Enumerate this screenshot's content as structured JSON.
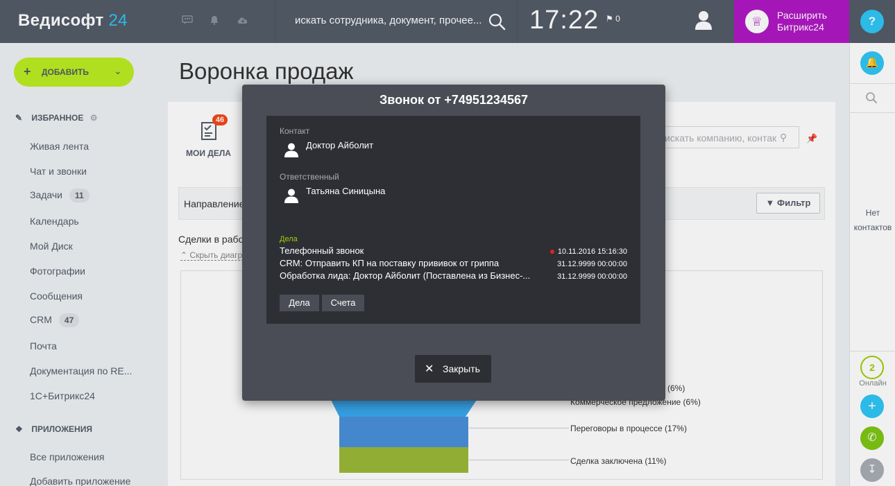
{
  "header": {
    "logo_main": "Ведисофт",
    "logo_num": "24",
    "search_placeholder": "искать сотрудника, документ, прочее...",
    "clock": "17:22",
    "flag_count": "0",
    "extend_line1": "Расширить",
    "extend_line2": "Битрикс24",
    "help": "?"
  },
  "sidebar": {
    "add_label": "ДОБАВИТЬ",
    "favorites_title": "ИЗБРАННОЕ",
    "items": [
      {
        "label": "Живая лента"
      },
      {
        "label": "Чат и звонки"
      },
      {
        "label": "Задачи",
        "badge": "11"
      },
      {
        "label": "Календарь"
      },
      {
        "label": "Мой Диск"
      },
      {
        "label": "Фотографии"
      },
      {
        "label": "Сообщения"
      },
      {
        "label": "CRM",
        "badge": "47"
      },
      {
        "label": "Почта"
      },
      {
        "label": "Документация по RE..."
      },
      {
        "label": "1С+Битрикс24"
      }
    ],
    "apps_title": "ПРИЛОЖЕНИЯ",
    "apps_items": [
      {
        "label": "Все приложения"
      },
      {
        "label": "Добавить приложение"
      }
    ]
  },
  "main": {
    "title": "Воронка продаж",
    "my_tasks_label": "МОИ ДЕЛА",
    "my_tasks_badge": "46",
    "search_placeholder": "искать компанию, контак",
    "direction_label": "Направление",
    "filter_label": "Фильтр",
    "deals_label": "Сделки в рабо",
    "hide_chart": "Скрыть диагра",
    "legend": [
      {
        "label": "(6%)"
      },
      {
        "label": "Коммерческое предложение (6%)"
      },
      {
        "label": "Переговоры в процессе (17%)"
      },
      {
        "label": "Сделка заключена (11%)"
      }
    ]
  },
  "rightbar": {
    "no_contacts_1": "Нет",
    "no_contacts_2": "контактов",
    "online_count": "2",
    "online_label": "Онлайн"
  },
  "modal": {
    "title": "Звонок от +74951234567",
    "contact_label": "Контакт",
    "contact_name": "Доктор Айболит",
    "responsible_label": "Ответственный",
    "responsible_name": "Татьяна Синицына",
    "tasks_label": "Дела",
    "tasks": [
      {
        "title": "Телефонный звонок",
        "date": "10.11.2016 15:16:30",
        "overdue": true
      },
      {
        "title": "CRM: Отправить КП на поставку прививок от гриппа",
        "date": "31.12.9999 00:00:00",
        "overdue": false
      },
      {
        "title": "Обработка лида: Доктор Айболит (Поставлена из Бизнес-...",
        "date": "31.12.9999 00:00:00",
        "overdue": false
      }
    ],
    "tab_tasks": "Дела",
    "tab_invoices": "Счета",
    "close_label": "Закрыть"
  },
  "colors": {
    "accent_blue": "#2fc6f6",
    "accent_green": "#bbed21",
    "topbar": "#535c69",
    "extend_purple": "#b018c4",
    "funnel_blue": "#4a90d9",
    "funnel_green": "#9cb838"
  }
}
